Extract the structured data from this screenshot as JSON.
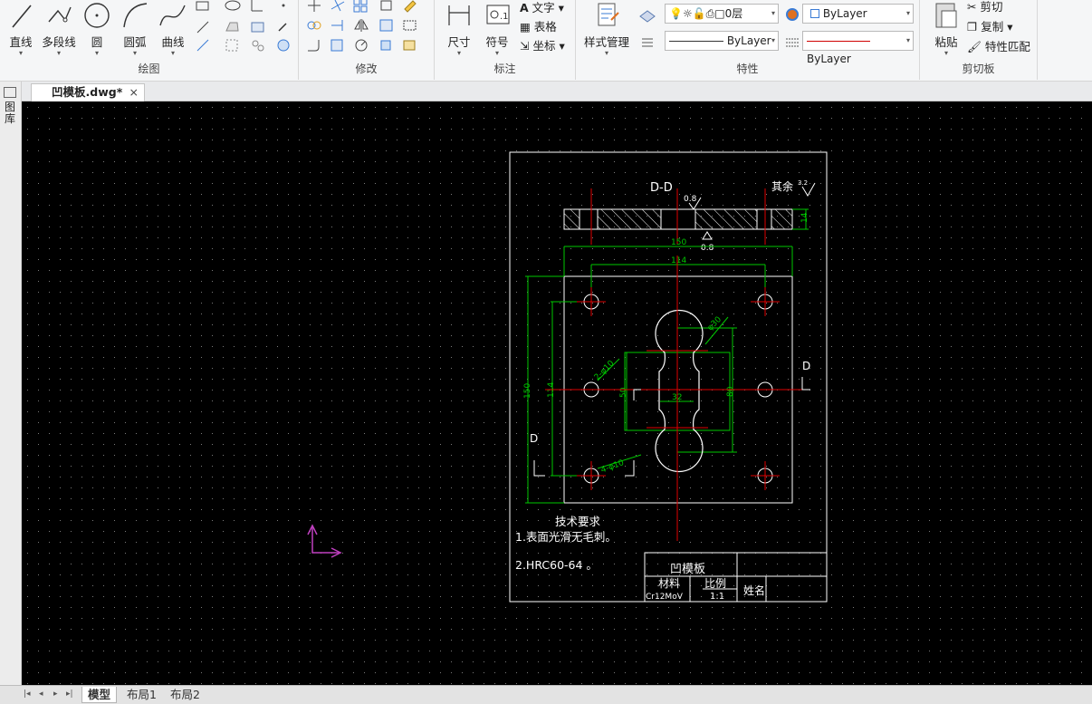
{
  "ribbon": {
    "draw": {
      "title": "绘图",
      "tools": [
        {
          "label": "直线"
        },
        {
          "label": "多段线"
        },
        {
          "label": "圆"
        },
        {
          "label": "圆弧"
        },
        {
          "label": "曲线"
        }
      ]
    },
    "modify": {
      "title": "修改"
    },
    "annotate": {
      "title": "标注",
      "dimension_label": "尺寸",
      "symbol_label": "符号",
      "text_label": "文字",
      "table_label": "表格",
      "coord_label": "坐标"
    },
    "properties": {
      "title": "特性",
      "style_manager_label": "样式管理",
      "layer_value": "0层",
      "color_value": "ByLayer",
      "linetype_value": "ByLayer",
      "lineweight_value": "ByLayer"
    },
    "clipboard": {
      "title": "剪切板",
      "paste_label": "粘贴",
      "cut_label": "剪切",
      "copy_label": "复制",
      "match_label": "特性匹配"
    },
    "colors": {
      "linetype_red": "#d00000"
    }
  },
  "document": {
    "tab_title": "凹模板.dwg*",
    "close_glyph": "×"
  },
  "sidebar": {
    "vertical_label": "图库"
  },
  "drawing": {
    "section_label": "D-D",
    "roughness_note": "其余",
    "roughness_value_top": "3.2",
    "roughness_value": "0.8",
    "roughness_value_bottom": "0.8",
    "dimensions": {
      "width_outer": "150",
      "width_inner": "114",
      "height_outer": "150",
      "height_inner": "114",
      "thickness": "14",
      "slot_dia": "φ30",
      "hole_dia": "4-φ10",
      "hole_dia_center": "2-φ10",
      "center_width": "50",
      "neck_width": "32",
      "slot_length": "80"
    },
    "section_mark": "D",
    "tech_req_title": "技术要求",
    "tech_req_1": "1.表面光滑无毛刺。",
    "tech_req_2": "2.HRC60-64 。",
    "title_block": {
      "part_name": "凹模板",
      "material_label": "材料",
      "scale_label": "比例",
      "material_value": "Cr12MoV",
      "scale_value": "1:1",
      "name_label": "姓名"
    },
    "colors": {
      "white": "#ffffff",
      "green": "#00c800",
      "red": "#e00000",
      "magenta": "#c040c0"
    }
  },
  "layout_tabs": [
    {
      "label": "模型",
      "active": true
    },
    {
      "label": "布局1",
      "active": false
    },
    {
      "label": "布局2",
      "active": false
    }
  ]
}
